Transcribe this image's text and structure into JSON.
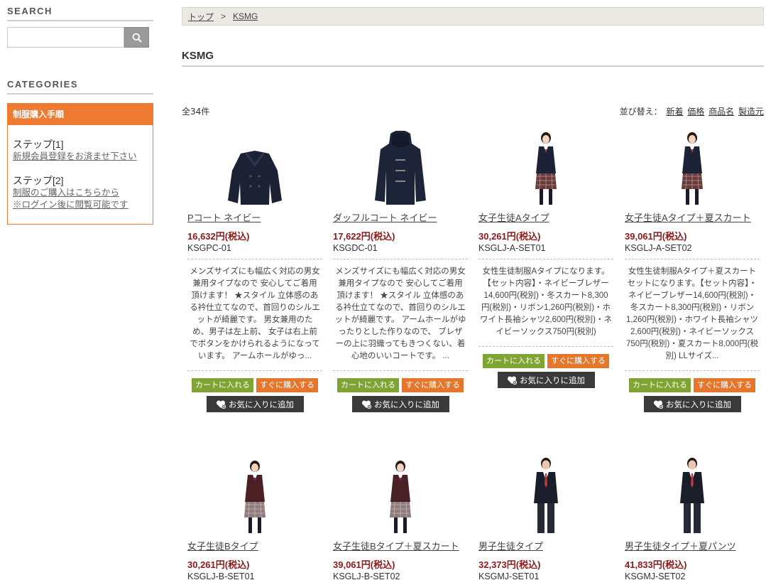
{
  "sidebar": {
    "search_heading": "SEARCH",
    "search_value": "",
    "categories_heading": "CATEGORIES",
    "category_box_title": "制服購入手順",
    "steps": [
      {
        "label": "ステップ[1]",
        "links": [
          "新規会員登録をお済ませ下さい"
        ]
      },
      {
        "label": "ステップ[2]",
        "links": [
          "制服のご購入はこちらから",
          "※ログイン後に閲覧可能です"
        ]
      }
    ]
  },
  "breadcrumb": {
    "home": "トップ",
    "separator": ">",
    "current": "KSMG"
  },
  "page_title": "KSMG",
  "listing": {
    "count": "全34件",
    "sort_label": "並び替え：",
    "sort_options": [
      "新着",
      "価格",
      "商品名",
      "製造元"
    ]
  },
  "buttons": {
    "cart": "カートに入れる",
    "buy_now": "すぐに購入する",
    "favorite": "お気に入りに追加"
  },
  "products": [
    {
      "name": "Pコート ネイビー",
      "price": "16,632円(税込)",
      "code": "KSGPC-01",
      "image": "pea-coat-navy",
      "description": "メンズサイズにも幅広く対応の男女兼用タイプなので 安心してご着用頂けます！ ★スタイル 立体感のある衿仕立てなので、首回りのシルエットが綺麗です。 男女兼用のため、男子は左上前、 女子は右上前でボタンをかけられるようになっています。 アームホールがゆっ..."
    },
    {
      "name": "ダッフルコート ネイビー",
      "price": "17,622円(税込)",
      "code": "KSGDC-01",
      "image": "duffle-coat-navy",
      "description": "メンズサイズにも幅広く対応の男女兼用タイプなので 安心してご着用頂けます！ ★スタイル 立体感のある衿仕立てなので、首回りのシルエットが綺麗です。 アームホールがゆったりとした作りなので、 ブレザーの上に羽織ってもきつくない、着心地のいいコートです。 ..."
    },
    {
      "name": "女子生徒Aタイプ",
      "price": "30,261円(税込)",
      "code": "KSGLJ-A-SET01",
      "image": "girl-navy-blazer",
      "description": "女性生徒制服Aタイプになります。【セット内容】・ネイビーブレザー14,600円(税別)・冬スカート8,300円(税別)・リボン1,260円(税別)・ホワイト長袖シャツ2,600円(税別)・ネイビーソックス750円(税別)"
    },
    {
      "name": "女子生徒Aタイプ＋夏スカート",
      "price": "39,061円(税込)",
      "code": "KSGLJ-A-SET02",
      "image": "girl-navy-blazer",
      "description": "女性生徒制服Aタイプ＋夏スカートセットになります。【セット内容】・ネイビーブレザー14,600円(税別)・冬スカート8,300円(税別)・リボン1,260円(税別)・ホワイト長袖シャツ2,600円(税別)・ネイビーソックス750円(税別)・夏スカート8,000円(税別) LLサイズ..."
    },
    {
      "name": "女子生徒Bタイプ",
      "price": "30,261円(税込)",
      "code": "KSGLJ-B-SET01",
      "image": "girl-brown-blazer"
    },
    {
      "name": "女子生徒Bタイプ＋夏スカート",
      "price": "39,061円(税込)",
      "code": "KSGLJ-B-SET02",
      "image": "girl-brown-blazer"
    },
    {
      "name": "男子生徒タイプ",
      "price": "32,373円(税込)",
      "code": "KSGMJ-SET01",
      "image": "boy-navy-blazer"
    },
    {
      "name": "男子生徒タイプ＋夏パンツ",
      "price": "41,833円(税込)",
      "code": "KSGMJ-SET02",
      "image": "boy-navy-blazer"
    }
  ],
  "colors": {
    "accent_orange": "#ee7a32",
    "cart_green": "#7fa433",
    "buy_orange": "#e5772c",
    "favorite_dark": "#3a3a3a",
    "price_red": "#8b1a1a"
  },
  "icons": {
    "search": "search-icon",
    "favorite": "heart-plus-icon"
  }
}
